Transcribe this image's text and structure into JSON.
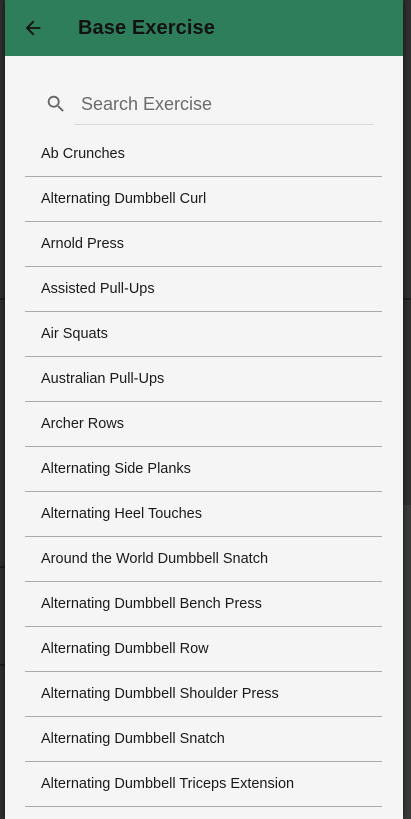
{
  "appbar": {
    "title": "Base Exercise"
  },
  "search": {
    "placeholder": "Search Exercise",
    "value": ""
  },
  "icons": {
    "back": "arrow-back-icon",
    "search": "search-icon"
  },
  "colors": {
    "appbar": "#2e7d5b",
    "dialog_bg": "#f5f5f5"
  },
  "exercises": [
    "Ab Crunches",
    "Alternating Dumbbell Curl",
    "Arnold Press",
    "Assisted Pull-Ups",
    "Air Squats",
    "Australian Pull-Ups",
    "Archer Rows",
    "Alternating Side Planks",
    "Alternating Heel Touches",
    "Around the World Dumbbell Snatch",
    "Alternating Dumbbell Bench Press",
    "Alternating Dumbbell Row",
    "Alternating Dumbbell Shoulder Press",
    "Alternating Dumbbell Snatch",
    "Alternating Dumbbell Triceps Extension"
  ]
}
